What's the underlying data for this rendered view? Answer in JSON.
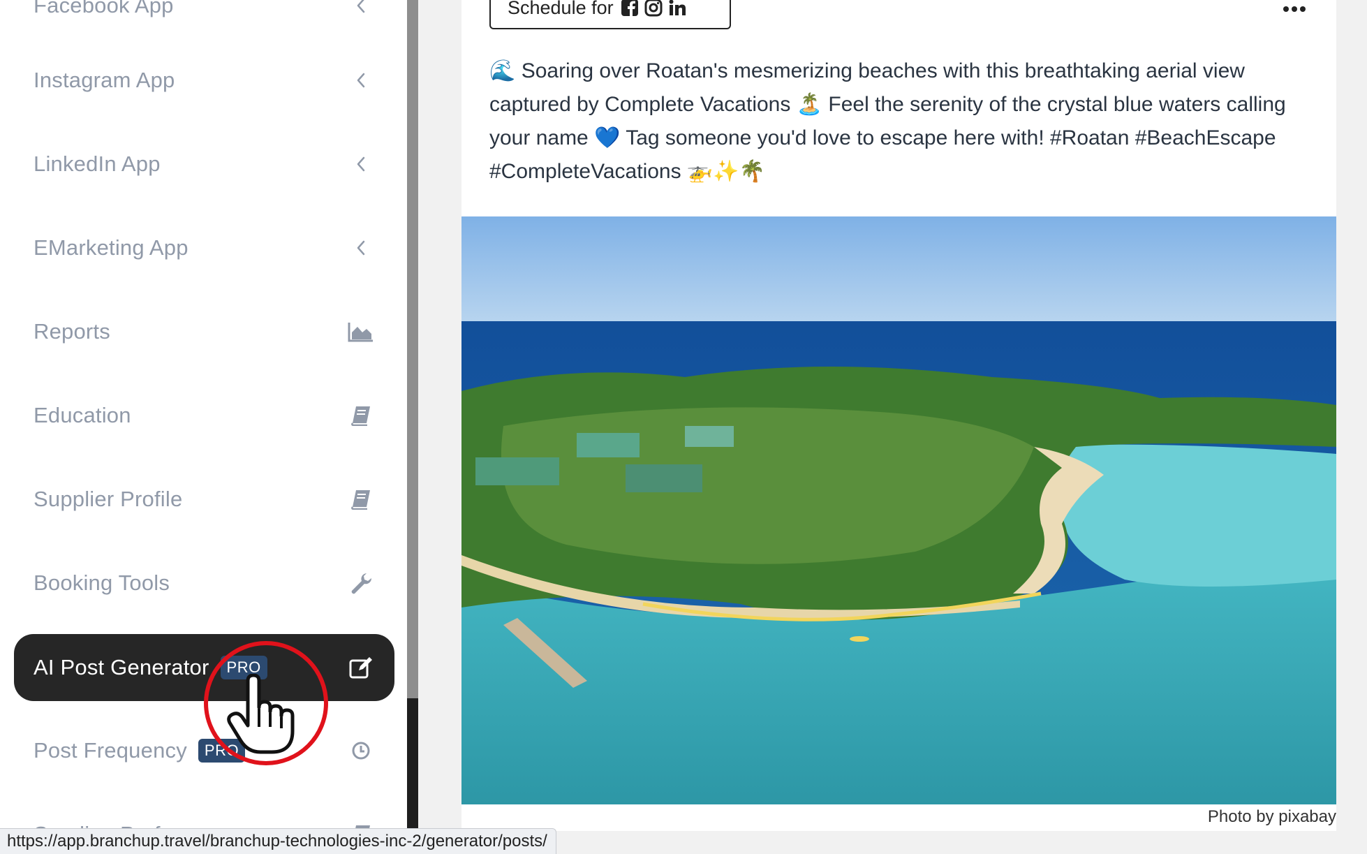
{
  "sidebar": {
    "items": [
      {
        "label": "Facebook App",
        "icon": "chevron-left-icon"
      },
      {
        "label": "Instagram App",
        "icon": "chevron-left-icon"
      },
      {
        "label": "LinkedIn App",
        "icon": "chevron-left-icon"
      },
      {
        "label": "EMarketing App",
        "icon": "chevron-left-icon"
      },
      {
        "label": "Reports",
        "icon": "area-chart-icon"
      },
      {
        "label": "Education",
        "icon": "book-icon"
      },
      {
        "label": "Supplier Profile",
        "icon": "book-icon"
      },
      {
        "label": "Booking Tools",
        "icon": "wrench-icon"
      },
      {
        "label": "AI Post Generator",
        "badge": "PRO",
        "icon": "edit-icon",
        "active": true
      },
      {
        "label": "Post Frequency",
        "badge": "PRO",
        "icon": "clock-icon"
      },
      {
        "label": "Sending Preferences",
        "icon": "book-icon"
      }
    ]
  },
  "post": {
    "schedule_label": "Schedule for",
    "text": "🌊 Soaring over Roatan's mesmerizing beaches with this breathtaking aerial view captured by Complete Vacations 🏝️ Feel the serenity of the crystal blue waters calling your name 💙 Tag someone you'd love to escape here with! #Roatan #BeachEscape #CompleteVacations 🚁✨🌴",
    "photo_credit": "Photo by pixabay"
  },
  "status_bar": {
    "url": "https://app.branchup.travel/branchup-technologies-inc-2/generator/posts/"
  },
  "colors": {
    "active_item_bg": "#262626",
    "badge_bg": "#2c4a70",
    "cursor_ring": "#e0121b",
    "menu_text": "#9099a8"
  }
}
